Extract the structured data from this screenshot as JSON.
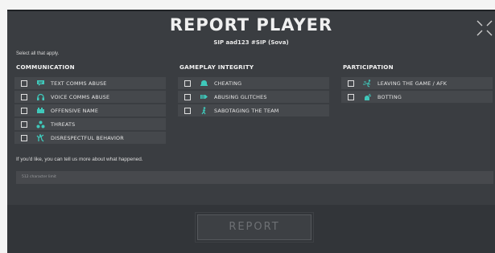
{
  "dialog": {
    "title": "REPORT PLAYER",
    "player": "SIP aad123 #SIP (Sova)",
    "instruction": "Select all that apply."
  },
  "categories": [
    {
      "heading": "COMMUNICATION",
      "options": [
        {
          "label": "TEXT COMMS ABUSE",
          "icon": "chat-icon",
          "checked": false
        },
        {
          "label": "VOICE COMMS ABUSE",
          "icon": "headset-icon",
          "checked": false
        },
        {
          "label": "OFFENSIVE NAME",
          "icon": "name-tag-icon",
          "checked": false
        },
        {
          "label": "THREATS",
          "icon": "threat-icon",
          "checked": false
        },
        {
          "label": "DISRESPECTFUL BEHAVIOR",
          "icon": "disrespect-icon",
          "checked": false
        }
      ]
    },
    {
      "heading": "GAMEPLAY INTEGRITY",
      "options": [
        {
          "label": "CHEATING",
          "icon": "cheating-icon",
          "checked": false
        },
        {
          "label": "ABUSING GLITCHES",
          "icon": "glitch-icon",
          "checked": false
        },
        {
          "label": "SABOTAGING THE TEAM",
          "icon": "sabotage-icon",
          "checked": false
        }
      ]
    },
    {
      "heading": "PARTICIPATION",
      "options": [
        {
          "label": "LEAVING THE GAME / AFK",
          "icon": "leave-icon",
          "checked": false
        },
        {
          "label": "BOTTING",
          "icon": "bot-icon",
          "checked": false
        }
      ]
    }
  ],
  "details": {
    "prompt": "If you'd like, you can tell us more about what happened.",
    "placeholder": "512 character limit"
  },
  "actions": {
    "report_label": "REPORT"
  },
  "colors": {
    "accent": "#3fc8ba",
    "panel": "#3a3d41",
    "option_bg": "#45484c"
  }
}
